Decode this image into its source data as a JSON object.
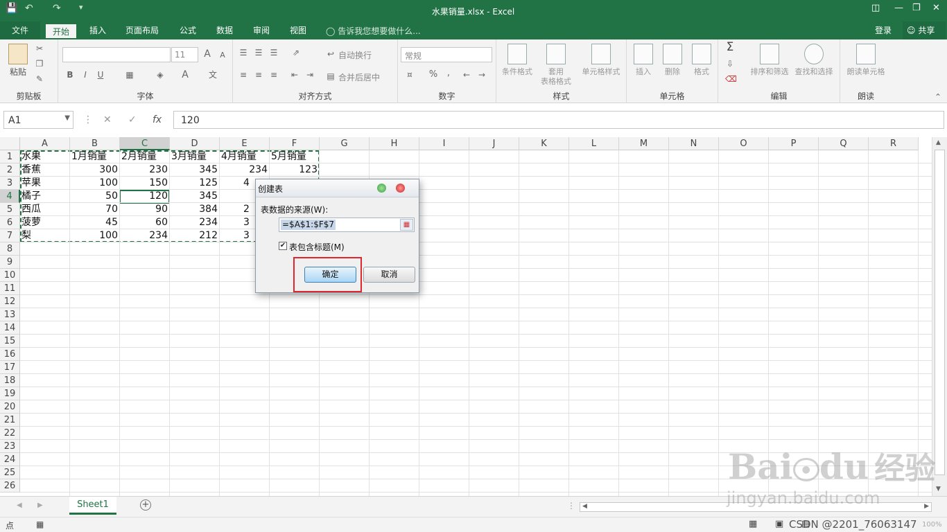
{
  "window": {
    "title": "水果销量.xlsx - Excel"
  },
  "quick_access": {
    "save_icon": "save-icon",
    "undo_icon": "undo-icon",
    "redo_icon": "redo-icon"
  },
  "tabs": [
    {
      "label": "文件"
    },
    {
      "label": "开始"
    },
    {
      "label": "插入"
    },
    {
      "label": "页面布局"
    },
    {
      "label": "公式"
    },
    {
      "label": "数据"
    },
    {
      "label": "审阅"
    },
    {
      "label": "视图"
    }
  ],
  "tell_me": "告诉我您想要做什么...",
  "account": {
    "signin": "登录",
    "share": "共享"
  },
  "ribbon": {
    "clipboard": {
      "paste": "粘贴",
      "label": "剪贴板"
    },
    "font": {
      "size": "11",
      "label": "字体",
      "bold": "B",
      "italic": "I",
      "underline": "U",
      "grow": "A",
      "shrink": "A",
      "color": "A"
    },
    "alignment": {
      "wrap": "自动换行",
      "merge": "合并后居中",
      "label": "对齐方式"
    },
    "number": {
      "format": "常规",
      "percent": "%",
      "comma": ",",
      "label": "数字"
    },
    "styles": {
      "conditional": "条件格式",
      "table": "套用\n表格格式",
      "cell": "单元格样式",
      "label": "样式"
    },
    "cells": {
      "insert": "插入",
      "delete": "删除",
      "format": "格式",
      "label": "单元格"
    },
    "editing": {
      "sort": "排序和筛选",
      "find": "查找和选择",
      "label": "编辑"
    },
    "read": {
      "read": "朗读单元格",
      "label": "朗读"
    }
  },
  "formula_bar": {
    "name_box": "A1",
    "fx": "fx",
    "cancel": "✕",
    "confirm": "✓",
    "value": "120"
  },
  "columns": [
    "A",
    "B",
    "C",
    "D",
    "E",
    "F",
    "G",
    "H",
    "I",
    "J",
    "K",
    "L",
    "M",
    "N",
    "O",
    "P",
    "Q",
    "R"
  ],
  "rows": [
    "1",
    "2",
    "3",
    "4",
    "5",
    "6",
    "7",
    "8",
    "9",
    "10",
    "11",
    "12",
    "13",
    "14",
    "15",
    "16",
    "17",
    "18",
    "19",
    "20",
    "21",
    "22",
    "23",
    "24",
    "25",
    "26"
  ],
  "sheet": {
    "headers": [
      "水果",
      "1月销量",
      "2月销量",
      "3月销量",
      "4月销量",
      "5月销量"
    ],
    "data": [
      [
        "香蕉",
        "300",
        "230",
        "345",
        "234",
        "123"
      ],
      [
        "苹果",
        "100",
        "150",
        "125",
        "",
        ""
      ],
      [
        "橘子",
        "50",
        "120",
        "345",
        "",
        ""
      ],
      [
        "西瓜",
        "70",
        "90",
        "384",
        "",
        ""
      ],
      [
        "菠萝",
        "45",
        "60",
        "234",
        "",
        ""
      ],
      [
        "梨",
        "100",
        "234",
        "212",
        "",
        ""
      ]
    ],
    "partial_e": {
      "r3": "4",
      "r5": "2",
      "r6": "3",
      "r7": "3"
    }
  },
  "dialog": {
    "title": "创建表",
    "source_label": "表数据的来源(W):",
    "source_value": "=$A$1:$F$7",
    "has_headers_label": "表包含标题(M)",
    "has_headers_checked": true,
    "ok": "确定",
    "cancel": "取消"
  },
  "sheet_tab": "Sheet1",
  "status": {
    "ready": "点",
    "watermark_text": "CSDN @2201_76063147",
    "zoom": "100%"
  },
  "watermark": {
    "brand": "Bai",
    "brand2": "du",
    "brand3": "经验",
    "url": "jingyan.baidu.com"
  }
}
